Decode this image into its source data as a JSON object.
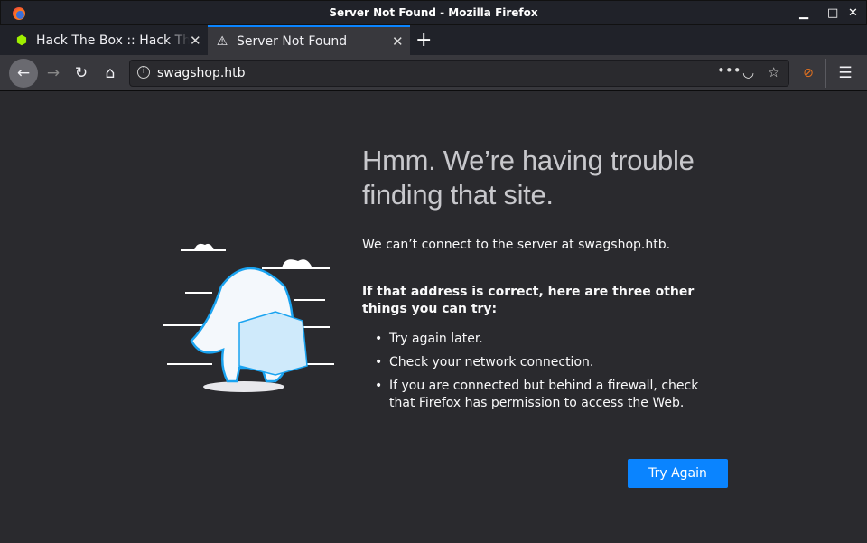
{
  "window": {
    "title": "Server Not Found - Mozilla Firefox",
    "minimize": "▁",
    "maximize": "□",
    "close": "✕"
  },
  "tabs": [
    {
      "label": "Hack The Box :: Hack The Box",
      "icon": "htb-cube-icon",
      "close": "✕"
    },
    {
      "label": "Server Not Found",
      "icon": "warning-icon",
      "close": "✕"
    }
  ],
  "new_tab": "+",
  "nav": {
    "url": "swagshop.htb"
  },
  "page": {
    "heading": "Hmm. We’re having trouble finding that site.",
    "intro": "We can’t connect to the server at swagshop.htb.",
    "suggest_title": "If that address is correct, here are three other things you can try:",
    "suggestions": [
      "Try again later.",
      "Check your network connection.",
      "If you are connected but behind a firewall, check that Firefox has permission to access the Web."
    ],
    "try_again": "Try Again"
  },
  "colors": {
    "accent": "#0a84ff",
    "background": "#2a2a2e"
  }
}
